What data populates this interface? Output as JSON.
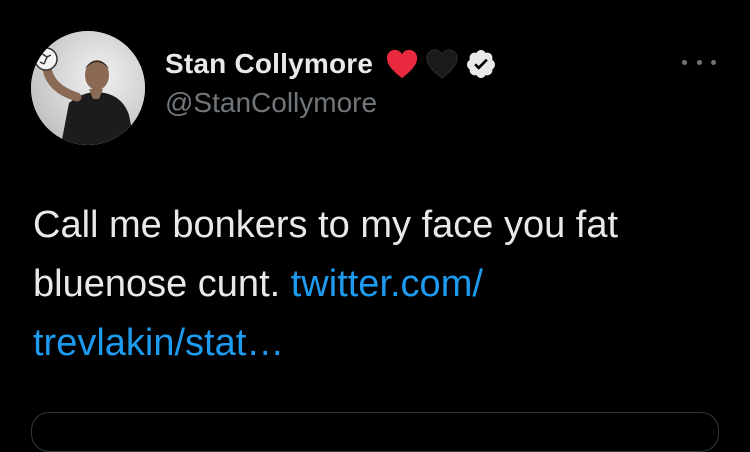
{
  "tweet": {
    "author": {
      "display_name": "Stan Collymore",
      "handle": "@StanCollymore",
      "name_emojis": [
        "red-heart-emoji",
        "black-heart-emoji"
      ],
      "verified": true
    },
    "text": {
      "plain": "Call me bonkers to my face you fat bluenose cunt.",
      "link": "twitter.com/\ntrevlakin/stat…"
    },
    "more_options_icon": "ellipsis-icon"
  },
  "colors": {
    "background": "#000000",
    "primary_text": "#e7e9ea",
    "secondary_text": "#71767b",
    "link": "#1d9bf0",
    "heart_red": "#e8293e",
    "heart_black": "#1a1a1a"
  }
}
